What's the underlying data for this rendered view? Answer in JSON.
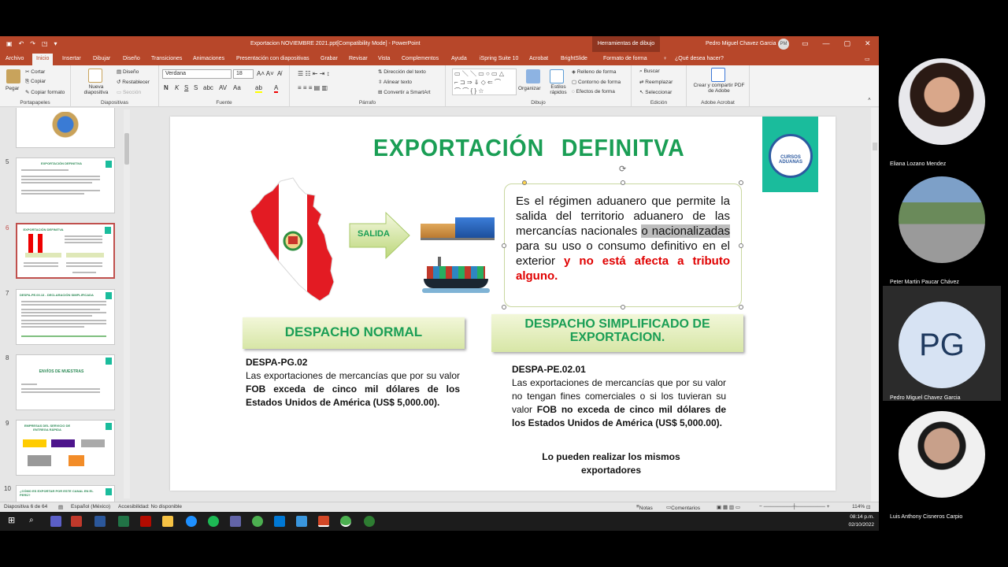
{
  "window": {
    "title": "Exportacion NOVIEMBRE 2021.ppt[Compatibility Mode]  -  PowerPoint",
    "context_tab": "Herramientas de dibujo",
    "user": "Pedro Miguel Chavez Garcia",
    "user_initials": "PM"
  },
  "tabs": [
    "Archivo",
    "Inicio",
    "Insertar",
    "Dibujar",
    "Diseño",
    "Transiciones",
    "Animaciones",
    "Presentación con diapositivas",
    "Grabar",
    "Revisar",
    "Vista",
    "Complementos",
    "Ayuda",
    "iSpring Suite 10",
    "Acrobat",
    "BrightSlide",
    "Formato de forma",
    "¿Qué desea hacer?"
  ],
  "ribbon": {
    "paste": "Pegar",
    "cut": "Cortar",
    "copy": "Copiar",
    "copy_format": "Copiar formato",
    "grp_clipboard": "Portapapeles",
    "new_slide": "Nueva diapositiva",
    "layout": "Diseño",
    "reset": "Restablecer",
    "section": "Sección",
    "grp_slides": "Diapositivas",
    "font": "Verdana",
    "font_size": "18",
    "grp_font": "Fuente",
    "text_dir": "Dirección del texto",
    "align_text": "Alinear texto",
    "smartart": "Convertir a SmartArt",
    "grp_paragraph": "Párrafo",
    "arrange": "Organizar",
    "quick_styles": "Estilos rápidos",
    "fill": "Relleno de forma",
    "outline": "Contorno de forma",
    "effects": "Efectos de forma",
    "grp_drawing": "Dibujo",
    "find": "Buscar",
    "replace": "Reemplazar",
    "select": "Seleccionar",
    "grp_editing": "Edición",
    "create_pdf": "Crear y compartir PDF de Adobe",
    "grp_acrobat": "Adobe Acrobat"
  },
  "thumbnails": [
    {
      "num": "",
      "title": ""
    },
    {
      "num": "5",
      "title": "EXPORTACIÓN DEFINITIVA"
    },
    {
      "num": "6",
      "title": "EXPORTACIÓN DEFINITVA"
    },
    {
      "num": "7",
      "title": "DESPA-PE.00.13 - DECLARACIÓN SIMPLIFICADA"
    },
    {
      "num": "8",
      "title": "ENVÍOS DE MUESTRAS"
    },
    {
      "num": "9",
      "title": "EMPRESAS DEL SERVICIO DE ENTREGA RÁPIDA"
    },
    {
      "num": "10",
      "title": "¿CÓMO ES EXPORTAR POR ESTE CANAL EN EL PERÚ?"
    }
  ],
  "slide": {
    "title": "EXPORTACIÓN  DEFINITVA",
    "salida": "SALIDA",
    "logo_text": "CURSOS ADUANAS",
    "def_1": "Es el régimen aduanero que permite la salida del territorio aduanero de las mercancías nacionales ",
    "def_hl": "o nacionalizadas ",
    "def_2": "para su uso o consumo definitivo en el exterior ",
    "def_red": "y no está afecta a tributo alguno.",
    "banner_1": "DESPACHO NORMAL",
    "banner_2": "DESPACHO SIMPLIFICADO DE EXPORTACION.",
    "code_1": "DESPA-PG.02",
    "text_1a": "Las exportaciones de mercancías que por su valor ",
    "text_1b": "FOB exceda de cinco mil dólares de los Estados Unidos de América (US$ 5,000.00).",
    "code_2": "DESPA-PE.02.01",
    "text_2a": "Las exportaciones de mercancías que por su valor no tengan fines comerciales o si los tuvieran su valor ",
    "text_2b": "FOB no exceda de cinco mil dólares de los Estados Unidos de América (US$ 5,000.00).",
    "note": "Lo pueden realizar los mismos exportadores"
  },
  "status": {
    "slide": "Diapositiva 6 de 64",
    "lang": "Español (México)",
    "access": "Accesibilidad: No disponible",
    "notes": "Notas",
    "comments": "Comentarios",
    "zoom": "114%"
  },
  "clock": {
    "time": "08:14 p.m.",
    "date": "02/10/2022"
  },
  "participants": [
    {
      "name": "Eliana Lozano Mendez"
    },
    {
      "name": "Peter Martin Paucar Chávez"
    },
    {
      "name": "Pedro Miguel Chavez Garcia",
      "initials": "PG"
    },
    {
      "name": "Luis Anthony Cisneros Carpio"
    }
  ]
}
